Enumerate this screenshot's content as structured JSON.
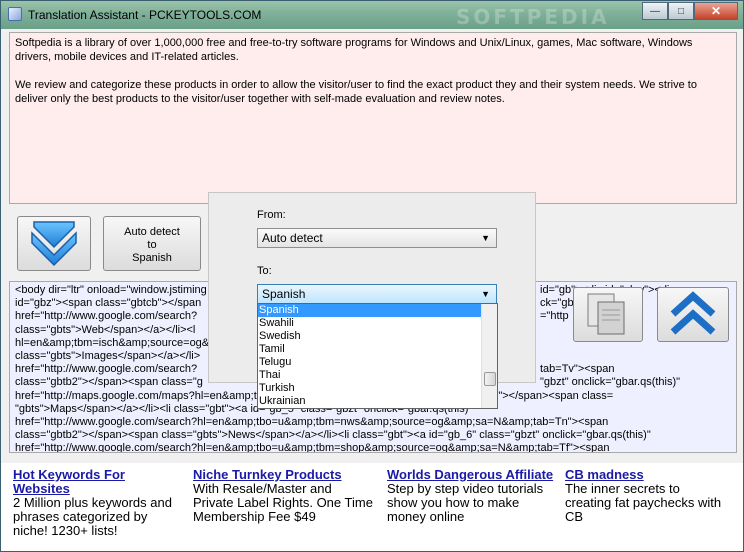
{
  "window": {
    "title": "Translation Assistant  -  PCKEYTOOLS.COM",
    "watermark": "SOFTPEDIA"
  },
  "source_text": {
    "p1": "Softpedia is a library of over 1,000,000 free and free-to-try software programs for Windows and Unix/Linux, games, Mac software, Windows drivers, mobile devices and IT-related articles.",
    "p2": "We review and categorize these products in order to allow the visitor/user to find the exact product they and their system needs. We strive to deliver only the best products to the visitor/user together with self-made evaluation and review notes."
  },
  "buttons": {
    "auto_detect": "Auto detect to Spanish"
  },
  "output_lines": [
    "<body dir=\"ltr\" onload=\"window.jstiming",
    "id=\"gbz\"><span class=\"gbtcb\"></span",
    "href=\"http://www.google.com/search?",
    "class=\"gbts\">Web</span></a></li><l",
    "hl=en&amp;tbm=isch&amp;source=og&",
    "class=\"gbts\">Images</span></a></li>",
    "href=\"http://www.google.com/search?",
    "class=\"gbtb2\"></span><span class=\"g",
    "href=\"http://maps.google.com/maps?hl=en&amp;tab=ll\" onclick=\"gbar.qs(this)\"><span class=\"gbtb2\"></span><span class=",
    "\"gbts\">Maps</span></a></li><li class=\"gbt\"><a id=\"gb_5\" class=\"gbzt\" onclick=\"gbar.qs(this)\"",
    "href=\"http://www.google.com/search?hl=en&amp;tbo=u&amp;tbm=nws&amp;source=og&amp;sa=N&amp;tab=Tn\"><span",
    "class=\"gbtb2\"></span><span class=\"gbts\">News</span></a></li><li class=\"gbt\"><a id=\"gb_6\" class=\"gbzt\" onclick=\"gbar.qs(this)\"",
    "href=\"http://www.google.com/search?hl=en&amp;tbo=u&amp;tbm=shop&amp;source=og&amp;sa=N&amp;tab=Tf\"><span"
  ],
  "output_right": [
    "id=\"gb\"><div id=\"gbw\"><div",
    "ck=\"gbar.qs(this)\"",
    "=\"http",
    "",
    "tab=Tv\"><span",
    "\"gbzt\" onclick=\"gbar.qs(this)\""
  ],
  "lang_panel": {
    "from_label": "From:",
    "from_value": "Auto detect",
    "to_label": "To:",
    "to_value": "Spanish",
    "options": [
      "Spanish",
      "Swahili",
      "Swedish",
      "Tamil",
      "Telugu",
      "Thai",
      "Turkish",
      "Ukrainian"
    ],
    "selected_index": 0
  },
  "ads": [
    {
      "head": "Hot Keywords For Websites",
      "body": "2 Million plus keywords and phrases categorized by niche! 1230+ lists!"
    },
    {
      "head": "Niche Turnkey Products",
      "body": "With Resale/Master and Private Label Rights. One Time Membership Fee $49"
    },
    {
      "head": "Worlds Dangerous Affiliate",
      "body": "Step by step video tutorials show you how to make money online"
    },
    {
      "head": "CB madness",
      "body": "The inner secrets to creating fat paychecks with CB"
    }
  ],
  "colors": {
    "accent": "#3399ff",
    "ad_link": "#1a1aa6",
    "source_bg": "#ffecec",
    "output_bg": "#eef0ff"
  }
}
